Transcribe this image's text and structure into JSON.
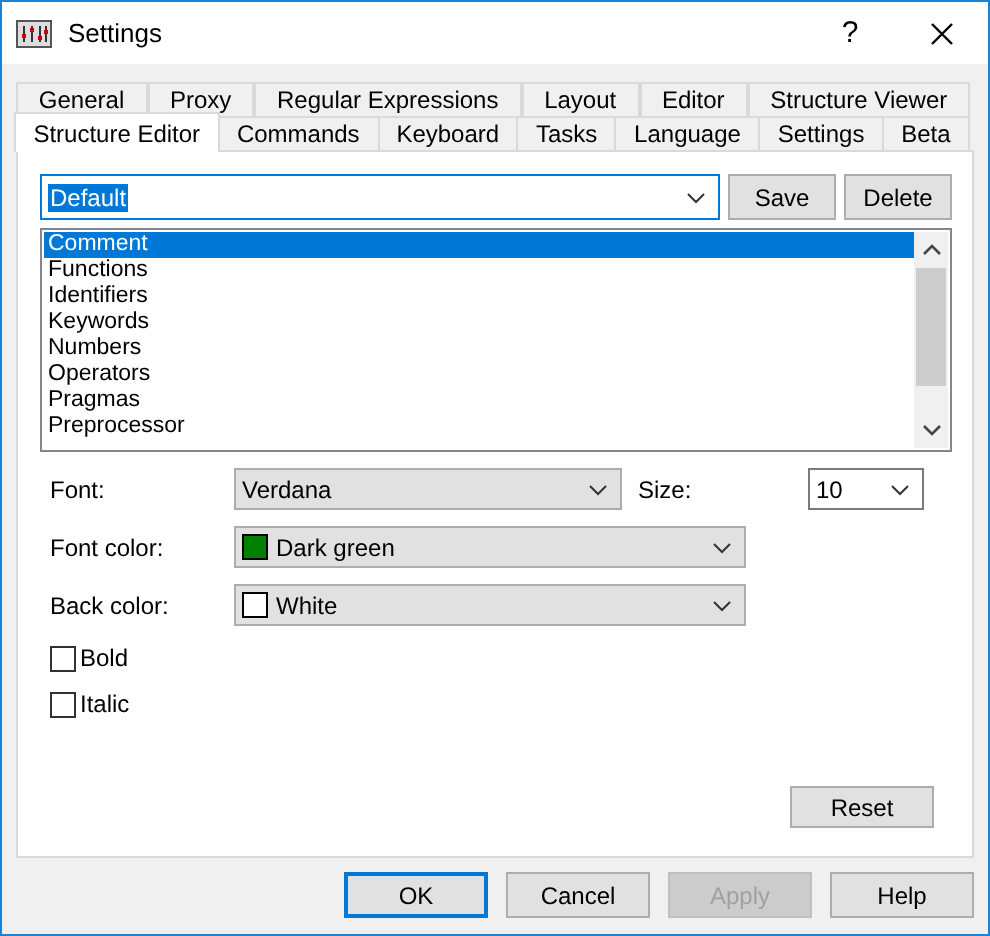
{
  "window": {
    "title": "Settings",
    "help": "?"
  },
  "tab_rows": [
    [
      {
        "label": "General",
        "selected": false
      },
      {
        "label": "Proxy",
        "selected": false
      },
      {
        "label": "Regular Expressions",
        "selected": false
      },
      {
        "label": "Layout",
        "selected": false
      },
      {
        "label": "Editor",
        "selected": false
      },
      {
        "label": "Structure Viewer",
        "selected": false
      }
    ],
    [
      {
        "label": "Structure Editor",
        "selected": true
      },
      {
        "label": "Commands",
        "selected": false
      },
      {
        "label": "Keyboard",
        "selected": false
      },
      {
        "label": "Tasks",
        "selected": false
      },
      {
        "label": "Language",
        "selected": false
      },
      {
        "label": "Settings",
        "selected": false
      },
      {
        "label": "Beta",
        "selected": false
      }
    ]
  ],
  "scheme": {
    "value": "Default",
    "buttons": [
      "Save",
      "Delete"
    ]
  },
  "elements": [
    {
      "label": "Comment",
      "selected": true
    },
    {
      "label": "Functions",
      "selected": false
    },
    {
      "label": "Identifiers",
      "selected": false
    },
    {
      "label": "Keywords",
      "selected": false
    },
    {
      "label": "Numbers",
      "selected": false
    },
    {
      "label": "Operators",
      "selected": false
    },
    {
      "label": "Pragmas",
      "selected": false
    },
    {
      "label": "Preprocessor",
      "selected": false
    }
  ],
  "font": {
    "label": "Font:",
    "value": "Verdana"
  },
  "size": {
    "label": "Size:",
    "value": "10"
  },
  "font_color": {
    "label": "Font color:",
    "value": "Dark green",
    "color": "#008000"
  },
  "back_color": {
    "label": "Back color:",
    "value": "White",
    "color": "#ffffff"
  },
  "checkboxes": [
    {
      "label": "Bold",
      "checked": false
    },
    {
      "label": "Italic",
      "checked": false
    }
  ],
  "reset_button": "Reset",
  "dialog_buttons": [
    {
      "label": "OK",
      "default": true,
      "disabled": false
    },
    {
      "label": "Cancel",
      "default": false,
      "disabled": false
    },
    {
      "label": "Apply",
      "default": false,
      "disabled": true
    },
    {
      "label": "Help",
      "default": false,
      "disabled": false
    }
  ]
}
